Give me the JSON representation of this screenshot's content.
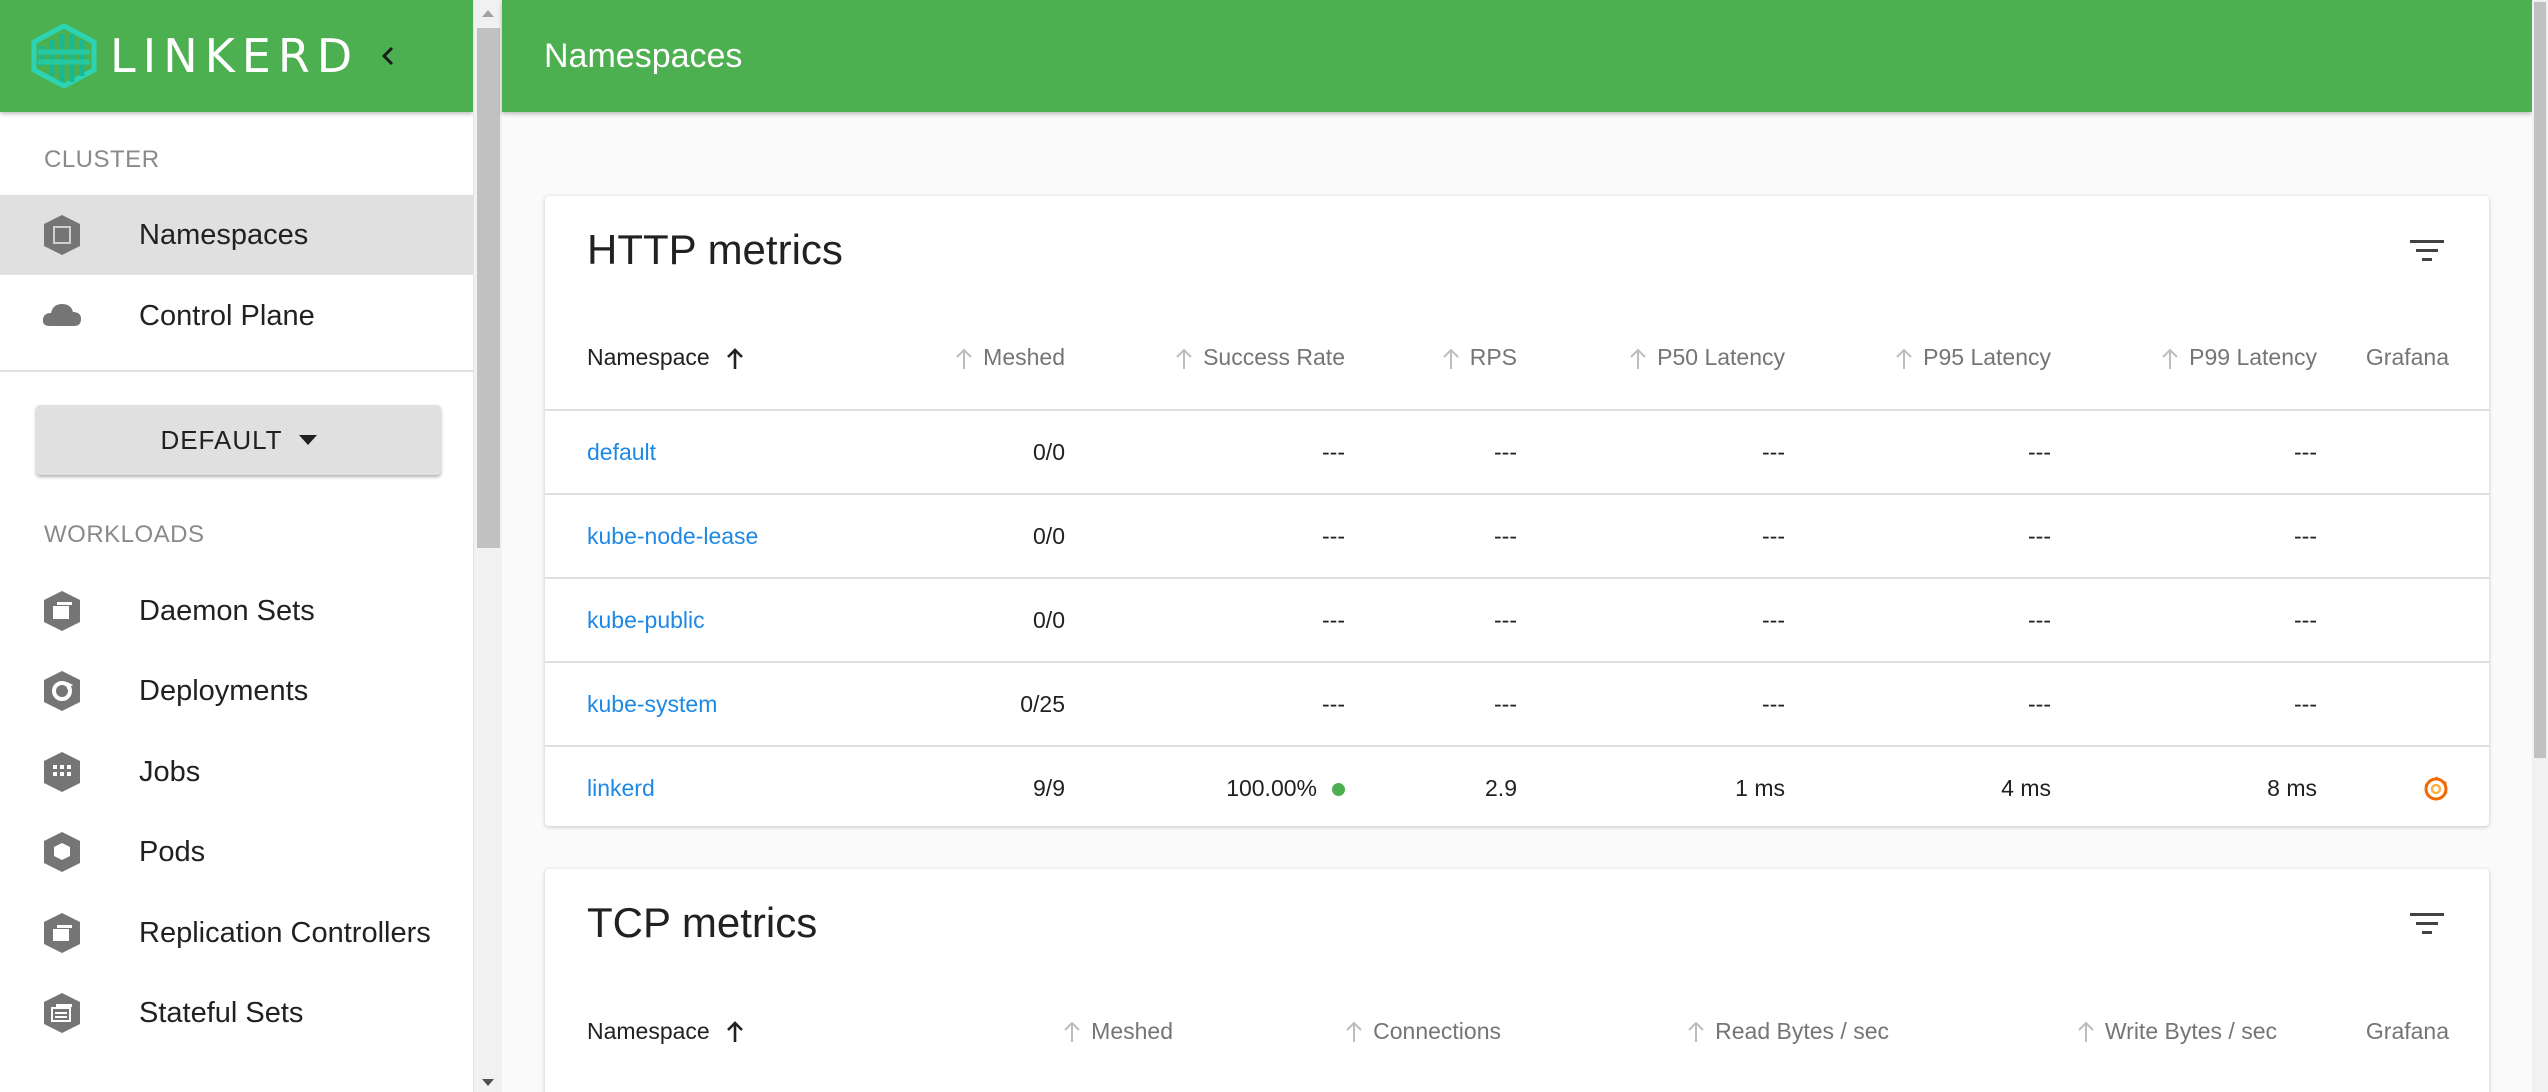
{
  "sidebar": {
    "brand": "LINKERD",
    "cluster_header": "CLUSTER",
    "cluster_items": [
      {
        "label": "Namespaces",
        "icon": "namespace-icon",
        "active": true
      },
      {
        "label": "Control Plane",
        "icon": "cloud-icon",
        "active": false
      }
    ],
    "namespace_select": "DEFAULT",
    "workloads_header": "WORKLOADS",
    "workload_items": [
      {
        "label": "Daemon Sets",
        "icon": "daemonset-icon"
      },
      {
        "label": "Deployments",
        "icon": "deployment-icon"
      },
      {
        "label": "Jobs",
        "icon": "job-icon"
      },
      {
        "label": "Pods",
        "icon": "pod-icon"
      },
      {
        "label": "Replication Controllers",
        "icon": "replicationcontroller-icon"
      },
      {
        "label": "Stateful Sets",
        "icon": "statefulset-icon"
      }
    ]
  },
  "header": {
    "title": "Namespaces"
  },
  "http": {
    "title": "HTTP metrics",
    "columns": [
      "Namespace",
      "Meshed",
      "Success Rate",
      "RPS",
      "P50 Latency",
      "P95 Latency",
      "P99 Latency",
      "Grafana"
    ],
    "rows": [
      {
        "namespace": "default",
        "meshed": "0/0",
        "success": "---",
        "rps": "---",
        "p50": "---",
        "p95": "---",
        "p99": "---",
        "grafana": false,
        "success_dot": false
      },
      {
        "namespace": "kube-node-lease",
        "meshed": "0/0",
        "success": "---",
        "rps": "---",
        "p50": "---",
        "p95": "---",
        "p99": "---",
        "grafana": false,
        "success_dot": false
      },
      {
        "namespace": "kube-public",
        "meshed": "0/0",
        "success": "---",
        "rps": "---",
        "p50": "---",
        "p95": "---",
        "p99": "---",
        "grafana": false,
        "success_dot": false
      },
      {
        "namespace": "kube-system",
        "meshed": "0/25",
        "success": "---",
        "rps": "---",
        "p50": "---",
        "p95": "---",
        "p99": "---",
        "grafana": false,
        "success_dot": false
      },
      {
        "namespace": "linkerd",
        "meshed": "9/9",
        "success": "100.00%",
        "rps": "2.9",
        "p50": "1 ms",
        "p95": "4 ms",
        "p99": "8 ms",
        "grafana": true,
        "success_dot": true
      }
    ]
  },
  "tcp": {
    "title": "TCP metrics",
    "columns": [
      "Namespace",
      "Meshed",
      "Connections",
      "Read Bytes / sec",
      "Write Bytes / sec",
      "Grafana"
    ]
  },
  "colors": {
    "brand_green": "#4caf50",
    "link_blue": "#1e88e5",
    "grafana_orange": "#f46800"
  }
}
